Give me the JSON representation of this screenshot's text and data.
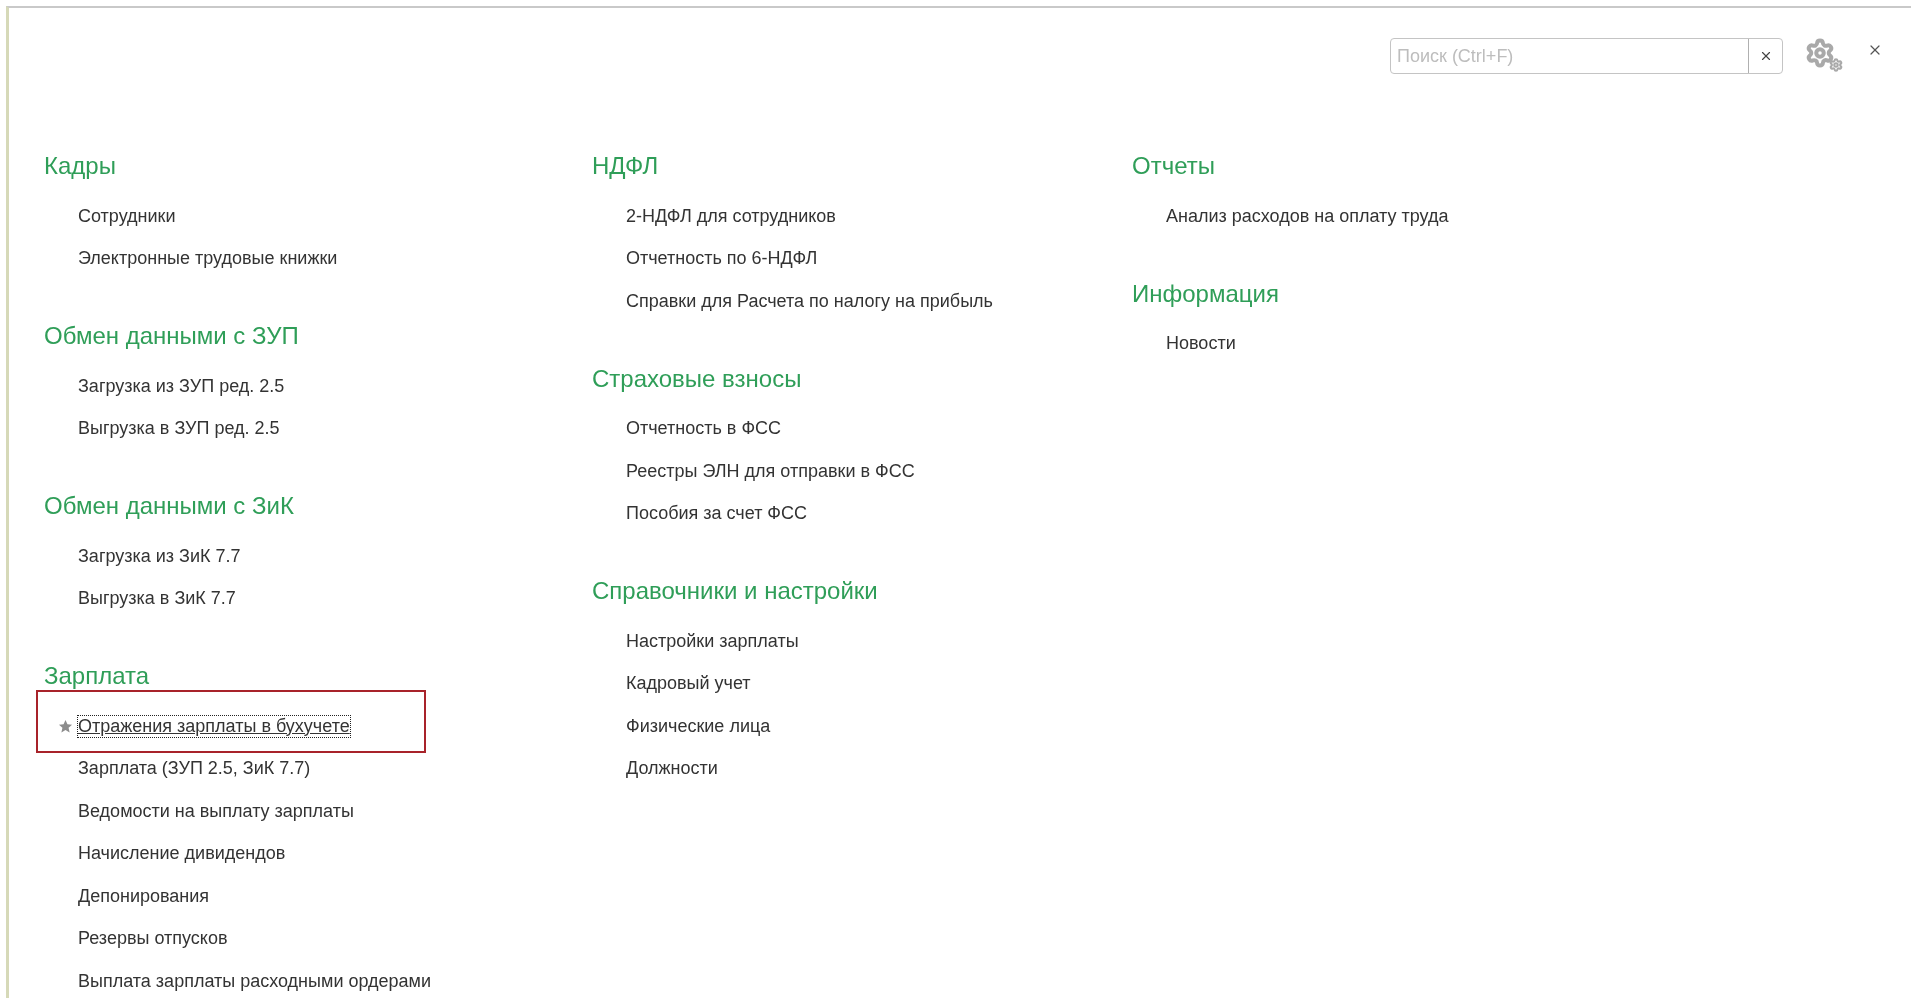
{
  "search": {
    "placeholder": "Поиск (Ctrl+F)"
  },
  "columns": [
    {
      "sections": [
        {
          "title": "Кадры",
          "items": [
            {
              "label": "Сотрудники"
            },
            {
              "label": "Электронные трудовые книжки"
            }
          ]
        },
        {
          "title": "Обмен данными с ЗУП",
          "items": [
            {
              "label": "Загрузка из ЗУП ред. 2.5"
            },
            {
              "label": "Выгрузка в ЗУП ред. 2.5"
            }
          ]
        },
        {
          "title": "Обмен данными с ЗиК",
          "items": [
            {
              "label": "Загрузка из ЗиК 7.7"
            },
            {
              "label": "Выгрузка в ЗиК 7.7"
            }
          ]
        },
        {
          "title": "Зарплата",
          "items": [
            {
              "label": "Отражения зарплаты в бухучете",
              "starred": true,
              "focused": true,
              "highlighted": true
            },
            {
              "label": "Зарплата (ЗУП 2.5, ЗиК 7.7)"
            },
            {
              "label": "Ведомости на выплату зарплаты"
            },
            {
              "label": "Начисление дивидендов"
            },
            {
              "label": "Депонирования"
            },
            {
              "label": "Резервы отпусков"
            },
            {
              "label": "Выплата зарплаты расходными ордерами"
            }
          ]
        }
      ]
    },
    {
      "sections": [
        {
          "title": "НДФЛ",
          "items": [
            {
              "label": "2-НДФЛ для сотрудников"
            },
            {
              "label": "Отчетность по 6-НДФЛ"
            },
            {
              "label": "Справки для Расчета по налогу на прибыль"
            }
          ]
        },
        {
          "title": "Страховые взносы",
          "items": [
            {
              "label": "Отчетность в ФСС"
            },
            {
              "label": "Реестры ЭЛН для отправки в ФСС"
            },
            {
              "label": "Пособия за счет ФСС"
            }
          ]
        },
        {
          "title": "Справочники и настройки",
          "items": [
            {
              "label": "Настройки зарплаты"
            },
            {
              "label": "Кадровый учет"
            },
            {
              "label": "Физические лица"
            },
            {
              "label": "Должности"
            }
          ]
        }
      ]
    },
    {
      "sections": [
        {
          "title": "Отчеты",
          "items": [
            {
              "label": "Анализ расходов на оплату труда"
            }
          ]
        },
        {
          "title": "Информация",
          "items": [
            {
              "label": "Новости"
            }
          ]
        }
      ]
    }
  ]
}
